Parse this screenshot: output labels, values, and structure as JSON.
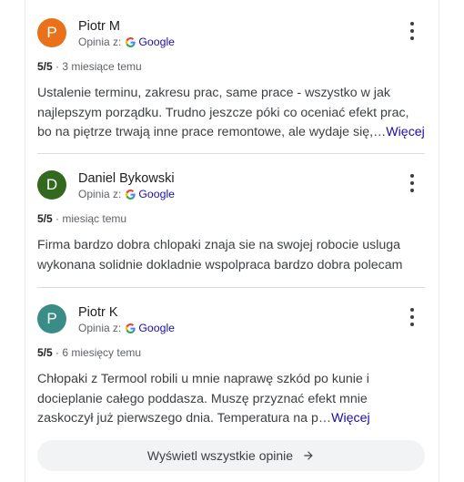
{
  "reviews": [
    {
      "initial": "P",
      "avatar_color": "#e8711a",
      "name": "Piotr M",
      "source_label": "Opinia z:",
      "source_name": "Google",
      "score": "5/5",
      "time": "· 3 miesiące temu",
      "lines": [
        "Ustalenie terminu, zakresu prac, same prace - wszystko w jak",
        "najlepszym porządku. Trudno jeszcze póki co oceniać efekt prac,",
        "bo na piętrze trwają inne prace remontowe, ale wydaje się,…"
      ],
      "more": "Więcej"
    },
    {
      "initial": "D",
      "avatar_color": "#33691e",
      "name": "Daniel Bykowski",
      "source_label": "Opinia z:",
      "source_name": "Google",
      "score": "5/5",
      "time": "· miesiąc temu",
      "lines": [
        "Firma bardzo dobra chlopaki znaja sie na swojej robocie usluga",
        "wykonana solidnie dokladnie wspolpraca bardzo dobra polecam"
      ]
    },
    {
      "initial": "P",
      "avatar_color": "#3a8c86",
      "name": "Piotr K",
      "source_label": "Opinia z:",
      "source_name": "Google",
      "score": "5/5",
      "time": "· 6 miesięcy temu",
      "lines": [
        "Chłopaki z Termool robili u mnie naprawę szkód po kunie i",
        "docieplanie całego poddasza. Muszę przyznać efekt mnie",
        "zaskoczył już pierwszego dnia. Temperatura na p…"
      ],
      "more": "Więcej"
    }
  ],
  "show_all_label": "Wyświetl wszystkie opinie"
}
